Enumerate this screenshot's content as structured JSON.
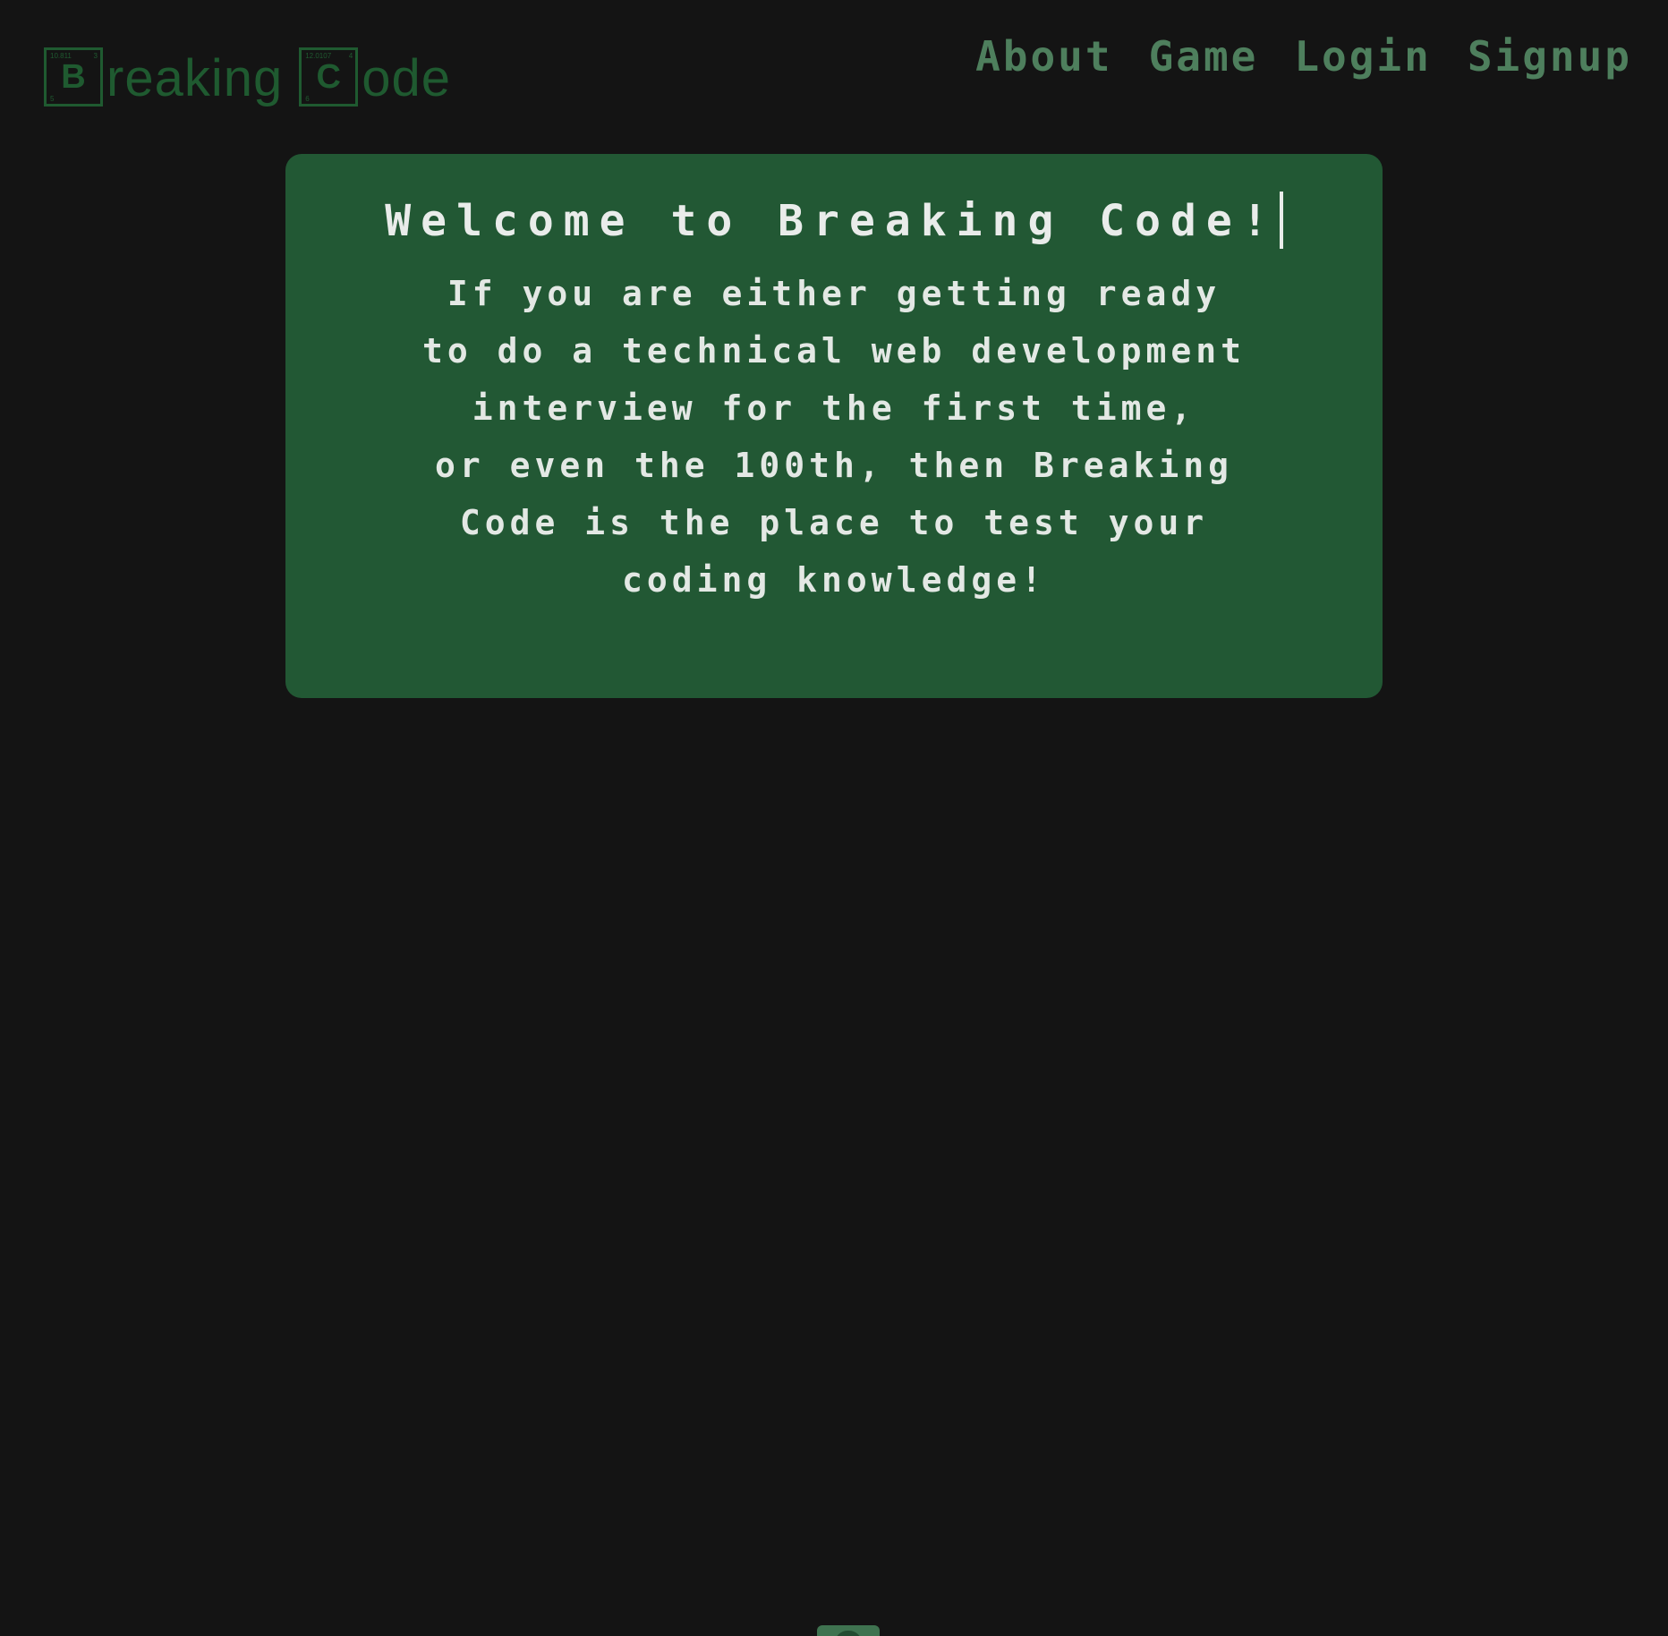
{
  "logo": {
    "box1": {
      "number": "10.811",
      "corner": "3",
      "small": "5",
      "symbol": "B"
    },
    "word1": "reaking",
    "box2": {
      "number": "12.0107",
      "corner": "4",
      "small": "6",
      "symbol": "C"
    },
    "word2": "ode"
  },
  "nav": {
    "about": "About",
    "game": "Game",
    "login": "Login",
    "signup": "Signup"
  },
  "card": {
    "title": "Welcome to Breaking Code!",
    "lines": [
      "If you are either getting ready",
      "to do a technical web development",
      "interview for the first time,",
      "or even the 100th, then Breaking",
      "Code is the place to test your",
      "coding knowledge!"
    ]
  },
  "colors": {
    "background": "#141414",
    "card": "#225834",
    "nav_text": "#4e7f5d",
    "logo": "#1f5a30",
    "card_text": "#e9ecea"
  }
}
